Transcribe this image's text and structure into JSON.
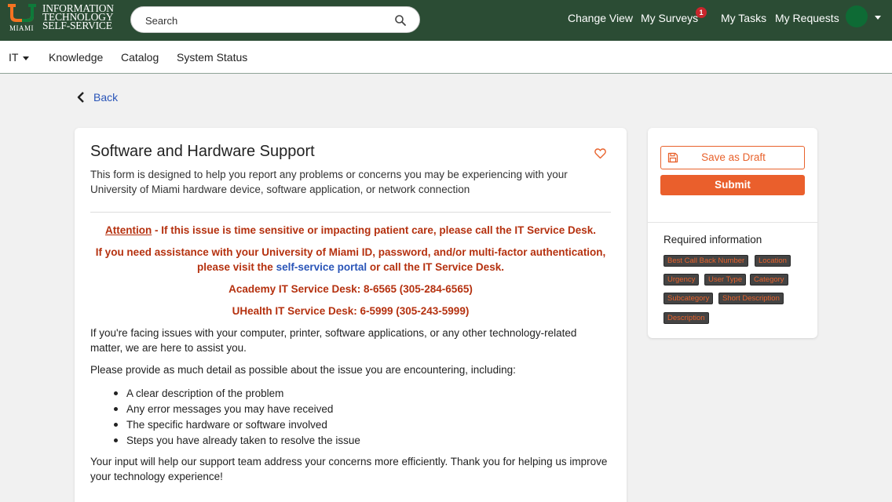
{
  "header": {
    "logo": {
      "text_lines": [
        "INFORMATION",
        "TECHNOLOGY",
        "SELF-SERVICE"
      ],
      "miami": "MIAMI",
      "colors": {
        "orange": "#f47321",
        "green": "#005030"
      }
    },
    "search": {
      "placeholder": "Search",
      "icon": "search-icon"
    },
    "nav": {
      "change_view": "Change View",
      "my_surveys": "My Surveys",
      "my_surveys_badge": "1",
      "my_tasks": "My Tasks",
      "my_requests": "My Requests"
    },
    "colors": {
      "background": "#2b4c34",
      "badge": "#c8262c"
    }
  },
  "subnav": {
    "items": [
      "IT",
      "Knowledge",
      "Catalog",
      "System Status"
    ]
  },
  "back": {
    "label": "Back"
  },
  "form": {
    "title": "Software and Hardware Support",
    "description": "This form is designed to help you report any problems or concerns you may be experiencing with your University of Miami hardware device, software application, or network connection",
    "attention": {
      "word": "Attention",
      "text": " - If this issue is time sensitive or impacting patient care, please call the IT Service Desk."
    },
    "assistance": {
      "before": "If you need assistance with your University of Miami ID, password, and/or multi-factor authentication, please visit the ",
      "link": "self-service portal",
      "after": " or call the IT Service Desk."
    },
    "academy_desk": "Academy IT Service Desk: 8-6565 (305-284-6565)",
    "uhealth_desk": "UHealth IT Service Desk: 6-5999 (305-243-5999)",
    "intro": "If you're facing issues with your computer, printer, software applications, or any other technology-related matter, we are here to assist you.",
    "detail_prompt": "Please provide as much detail as possible about the issue you are encountering, including:",
    "bullets": [
      "A clear description of the problem",
      "Any error messages you may have received",
      "The specific hardware or software involved",
      "Steps you have already taken to resolve the issue"
    ],
    "closing": "Your input will help our support team address your concerns more efficiently. Thank you for helping us improve your technology experience!",
    "colors": {
      "alert_red": "#b5310f",
      "link_blue": "#2a55b8"
    }
  },
  "sidebar": {
    "save_draft": "Save as Draft",
    "submit": "Submit",
    "required_title": "Required information",
    "required_fields": [
      "Best Call Back Number",
      "Location",
      "Urgency",
      "User Type",
      "Category",
      "Subcategory",
      "Short Description",
      "Description"
    ],
    "colors": {
      "accent": "#ea5f2c",
      "tag_bg": "#444444"
    }
  }
}
